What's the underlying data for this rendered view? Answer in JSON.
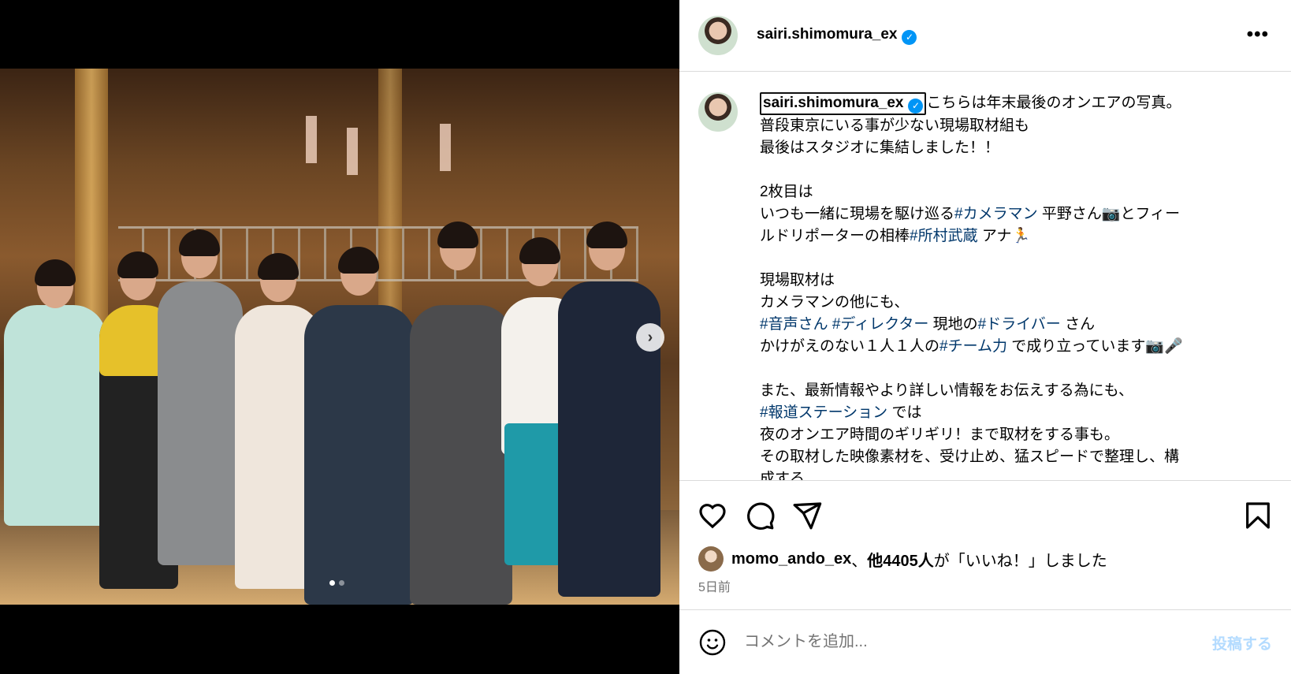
{
  "post": {
    "username": "sairi.shimomura_ex",
    "verified_icon": "verified-badge-icon",
    "more_label": "•••",
    "carousel_next": "›",
    "caption_lines": [
      {
        "parts": [
          {
            "t": "こちらは年末最後のオンエアの写真。"
          }
        ]
      },
      {
        "parts": [
          {
            "t": "普段東京にいる事が少ない現場取材組も"
          }
        ]
      },
      {
        "parts": [
          {
            "t": "最後はスタジオに集結しました！！"
          }
        ]
      },
      {
        "parts": [
          {
            "t": " "
          }
        ]
      },
      {
        "parts": [
          {
            "t": "2枚目は"
          }
        ]
      },
      {
        "parts": [
          {
            "t": "いつも一緒に現場を駆け巡る"
          },
          {
            "t": "#カメラマン",
            "tag": true
          },
          {
            "t": " 平野さん📷とフィー"
          }
        ]
      },
      {
        "parts": [
          {
            "t": "ルドリポーターの相棒"
          },
          {
            "t": "#所村武蔵",
            "tag": true
          },
          {
            "t": " アナ🏃"
          }
        ]
      },
      {
        "parts": [
          {
            "t": " "
          }
        ]
      },
      {
        "parts": [
          {
            "t": "現場取材は"
          }
        ]
      },
      {
        "parts": [
          {
            "t": "カメラマンの他にも、"
          }
        ]
      },
      {
        "parts": [
          {
            "t": "#音声さん",
            "tag": true
          },
          {
            "t": " "
          },
          {
            "t": "#ディレクター",
            "tag": true
          },
          {
            "t": " 現地の"
          },
          {
            "t": "#ドライバー",
            "tag": true
          },
          {
            "t": " さん"
          }
        ]
      },
      {
        "parts": [
          {
            "t": "かけがえのない１人１人の"
          },
          {
            "t": "#チーム力",
            "tag": true
          },
          {
            "t": " で成り立っています📷🎤"
          }
        ]
      },
      {
        "parts": [
          {
            "t": " "
          }
        ]
      },
      {
        "parts": [
          {
            "t": "また、最新情報やより詳しい情報をお伝えする為にも、"
          }
        ]
      },
      {
        "parts": [
          {
            "t": "#報道ステーション",
            "tag": true
          },
          {
            "t": " では"
          }
        ]
      },
      {
        "parts": [
          {
            "t": "夜のオンエア時間のギリギリ！まで取材をする事も。"
          }
        ]
      },
      {
        "parts": [
          {
            "t": "その取材した映像素材を、受け止め、猛スピードで整理し、構"
          }
        ]
      },
      {
        "parts": [
          {
            "t": "成する"
          }
        ]
      }
    ],
    "likes": {
      "user": "momo_ando_ex",
      "sep": "、",
      "count": "他4405人",
      "suffix": "が「いいね！」しました"
    },
    "time_ago": "5日前",
    "comment": {
      "placeholder": "コメントを追加...",
      "post_label": "投稿する"
    },
    "carousel": {
      "count": 2,
      "active": 0
    },
    "colors": {
      "accent": "#0095f6",
      "hashtag": "#00376b",
      "muted": "#737373"
    }
  }
}
